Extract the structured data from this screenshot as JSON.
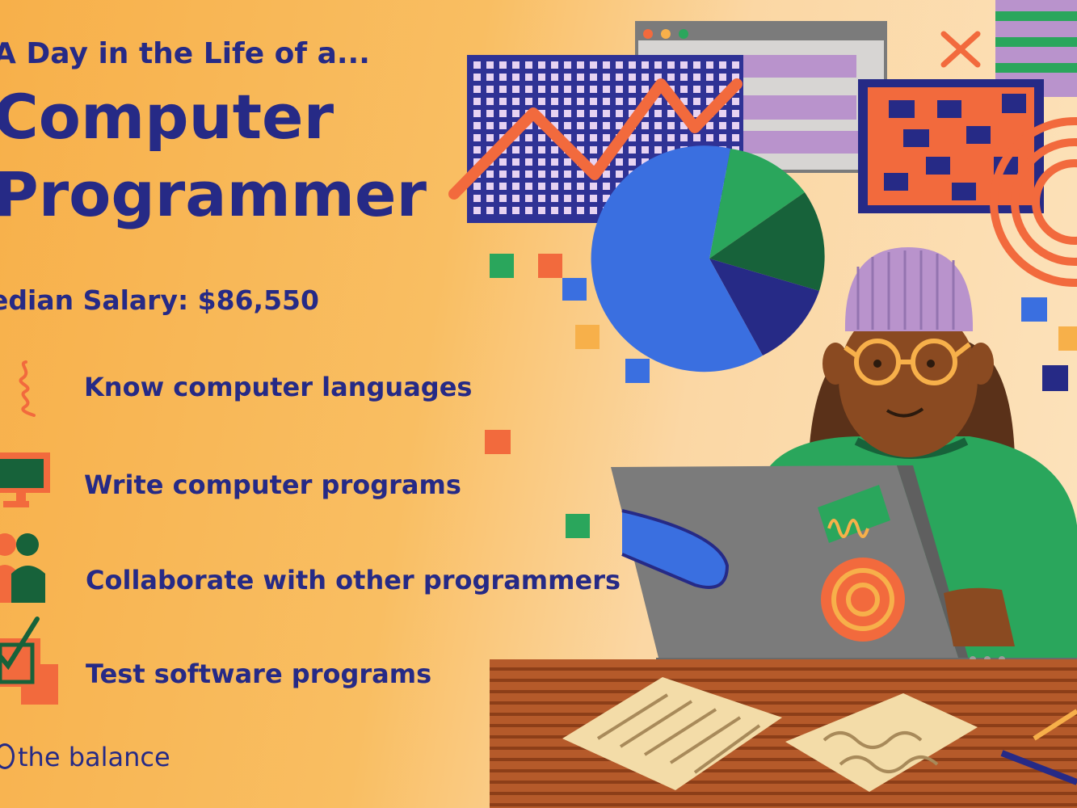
{
  "header": {
    "subtitle": "A Day in the Life of a...",
    "title_line1": "Computer",
    "title_line2": "Programmer"
  },
  "salary": "edian Salary: $86,550",
  "duties": [
    {
      "label": "Know computer languages",
      "icon": "curly-brace-icon"
    },
    {
      "label": "Write computer programs",
      "icon": "monitor-icon"
    },
    {
      "label": "Collaborate with other programmers",
      "icon": "people-icon"
    },
    {
      "label": "Test software programs",
      "icon": "checkbox-icon"
    }
  ],
  "brand": "the balance",
  "colors": {
    "navy": "#262a86",
    "orange": "#f26a3d",
    "green": "#2aa65c",
    "dark_green": "#17623a",
    "blue": "#3a6fe0",
    "purple": "#b993cc",
    "grey": "#7b7b7b"
  }
}
